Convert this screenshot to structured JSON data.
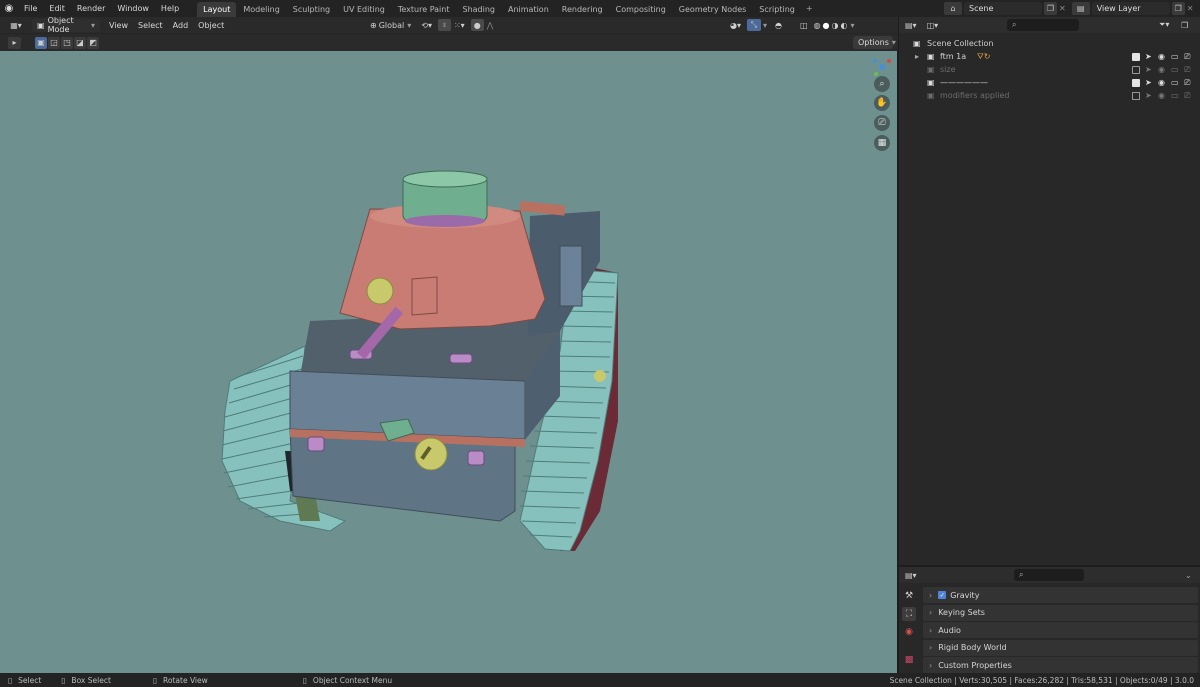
{
  "topbar": {
    "menus": [
      "File",
      "Edit",
      "Render",
      "Window",
      "Help"
    ],
    "workspaces": [
      "Layout",
      "Modeling",
      "Sculpting",
      "UV Editing",
      "Texture Paint",
      "Shading",
      "Animation",
      "Rendering",
      "Compositing",
      "Geometry Nodes",
      "Scripting"
    ],
    "active_workspace": "Layout",
    "scene": "Scene",
    "view_layer": "View Layer"
  },
  "viewport_header": {
    "mode": "Object Mode",
    "menus": [
      "View",
      "Select",
      "Add",
      "Object"
    ],
    "transform_orientation": "Global",
    "options_label": "Options"
  },
  "outliner": {
    "root": "Scene Collection",
    "items": [
      {
        "label": "ftm 1a",
        "dim": false,
        "checked": true
      },
      {
        "label": "size",
        "dim": true,
        "checked": false
      },
      {
        "label": "——————",
        "dim": false,
        "checked": true
      },
      {
        "label": "modifiers applied",
        "dim": true,
        "checked": false
      }
    ]
  },
  "properties": {
    "panels": [
      {
        "label": "Gravity",
        "checkbox": true
      },
      {
        "label": "Keying Sets",
        "checkbox": false
      },
      {
        "label": "Audio",
        "checkbox": false
      },
      {
        "label": "Rigid Body World",
        "checkbox": false
      },
      {
        "label": "Custom Properties",
        "checkbox": false
      }
    ]
  },
  "statusbar": {
    "select": "Select",
    "box_select": "Box Select",
    "rotate_view": "Rotate View",
    "context_menu": "Object Context Menu",
    "stats": "Scene Collection | Verts:30,505 | Faces:26,282 | Tris:58,531 | Objects:0/49 | 3.0.0"
  },
  "colors": {
    "viewport_bg": "#6e9190",
    "hull": "#5f7484",
    "turret": "#c97c73",
    "hatch": "#6fae8f",
    "track": "#86c1bd"
  }
}
